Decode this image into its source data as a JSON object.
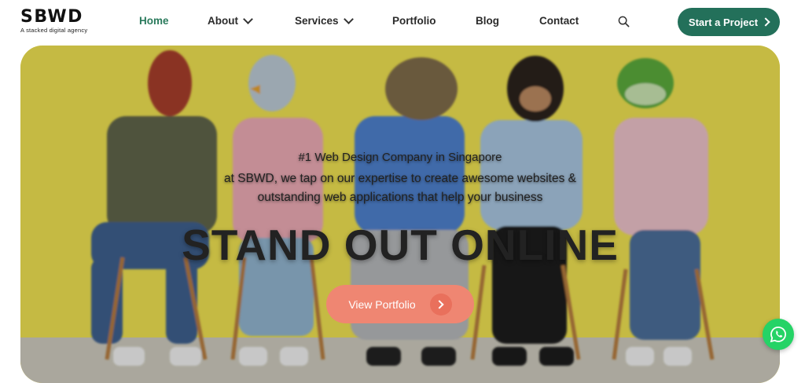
{
  "header": {
    "logo": {
      "name": "SBWD",
      "tagline": "A stacked digital agency"
    },
    "nav": [
      {
        "label": "Home",
        "active": true,
        "has_dropdown": false
      },
      {
        "label": "About",
        "active": false,
        "has_dropdown": true
      },
      {
        "label": "Services",
        "active": false,
        "has_dropdown": true
      },
      {
        "label": "Portfolio",
        "active": false,
        "has_dropdown": false
      },
      {
        "label": "Blog",
        "active": false,
        "has_dropdown": false
      },
      {
        "label": "Contact",
        "active": false,
        "has_dropdown": false
      }
    ],
    "search_icon": "search-icon",
    "cta_label": "Start a Project"
  },
  "hero": {
    "kicker": "#1 Web Design Company in Singapore",
    "subtitle_line1": "at SBWD, we tap on our expertise to create awesome websites &",
    "subtitle_line2": "outstanding web applications that help your business",
    "headline": "STAND OUT ONLINE",
    "button_label": "View Portfolio"
  },
  "floating": {
    "whatsapp_icon": "whatsapp-icon"
  },
  "colors": {
    "brand_green": "#23705a",
    "active_nav": "#2a7a5c",
    "hero_yellow": "#ecdf52",
    "portfolio_button": "#ef8672",
    "whatsapp": "#25d366"
  }
}
